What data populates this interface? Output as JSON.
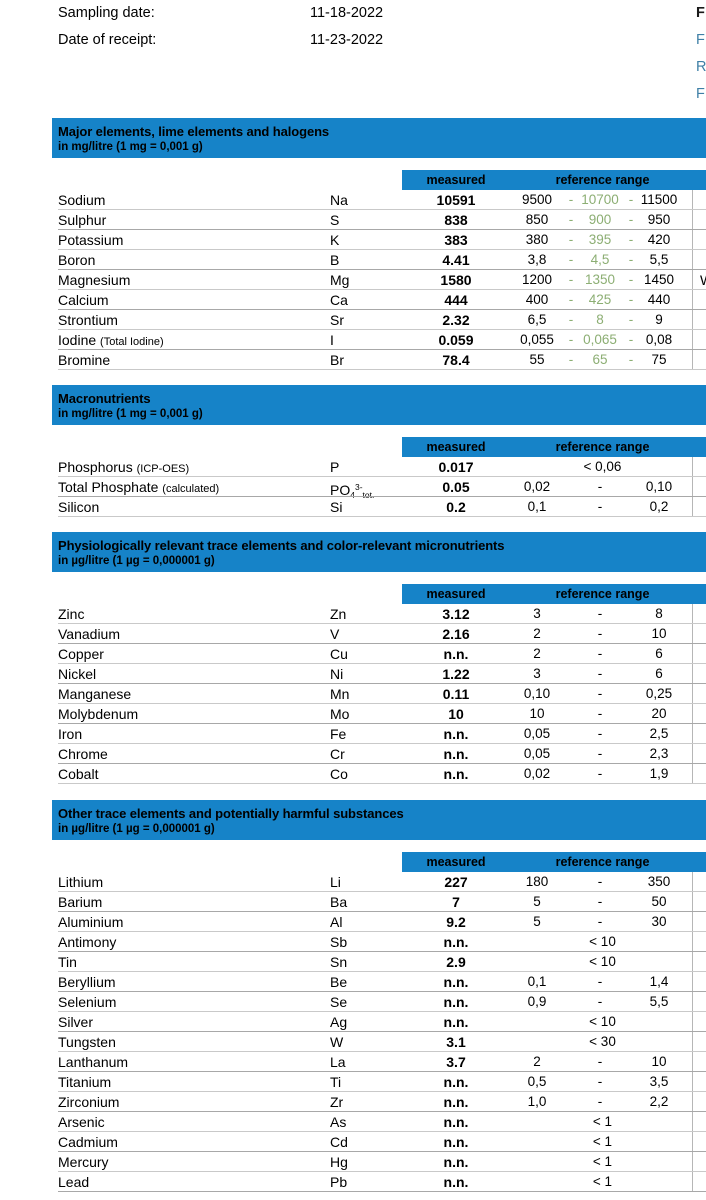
{
  "meta": {
    "rows": [
      {
        "label": "Sampling date:",
        "value": "11-18-2022"
      },
      {
        "label": "Date of receipt:",
        "value": "11-23-2022"
      }
    ]
  },
  "edge_links": [
    {
      "text": "F",
      "bold": true
    },
    {
      "text": "F",
      "bold": false
    },
    {
      "text": "R",
      "bold": false
    },
    {
      "text": "F",
      "bold": false
    }
  ],
  "columns": {
    "measured": "measured",
    "reference_range": "reference range"
  },
  "colors": {
    "section_blue": "#1683c8",
    "optimal_green": "#8cae73",
    "link_blue": "#3f7fa6",
    "rule_grey": "#c9c9c9"
  },
  "sections": [
    {
      "title": "Major elements, lime elements and halogens",
      "unit": "in mg/litre (1 mg = 0,001 g)",
      "rows": [
        {
          "name": "Sodium",
          "symbol": "Na",
          "measured": "10591",
          "low": "9500",
          "mid": "10700",
          "high": "11500"
        },
        {
          "name": "Sulphur",
          "symbol": "S",
          "measured": "838",
          "low": "850",
          "mid": "900",
          "high": "950"
        },
        {
          "name": "Potassium",
          "symbol": "K",
          "measured": "383",
          "low": "380",
          "mid": "395",
          "high": "420"
        },
        {
          "name": "Boron",
          "symbol": "B",
          "measured": "4.41",
          "low": "3,8",
          "mid": "4,5",
          "high": "5,5"
        },
        {
          "name": "Magnesium",
          "symbol": "Mg",
          "measured": "1580",
          "low": "1200",
          "mid": "1350",
          "high": "1450",
          "edge_mark": "W"
        },
        {
          "name": "Calcium",
          "symbol": "Ca",
          "measured": "444",
          "low": "400",
          "mid": "425",
          "high": "440"
        },
        {
          "name": "Strontium",
          "symbol": "Sr",
          "measured": "2.32",
          "low": "6,5",
          "mid": "8",
          "high": "9"
        },
        {
          "name": "Iodine",
          "name_sub": "(Total Iodine)",
          "symbol": "I",
          "measured": "0.059",
          "low": "0,055",
          "mid": "0,065",
          "high": "0,08"
        },
        {
          "name": "Bromine",
          "symbol": "Br",
          "measured": "78.4",
          "low": "55",
          "mid": "65",
          "high": "75"
        }
      ]
    },
    {
      "title": "Macronutrients",
      "unit": "in mg/litre (1 mg = 0,001 g)",
      "rows": [
        {
          "name": "Phosphorus",
          "name_sub": "(ICP-OES)",
          "symbol": "P",
          "measured": "0.017",
          "single": "< 0,06"
        },
        {
          "name": "Total Phosphate",
          "name_sub": "(calculated)",
          "symbol_html": "PO<sub>4</sub><sup>3-</sup><sub>tot.</sub>",
          "symbol": "PO4 3- tot.",
          "measured": "0.05",
          "low": "0,02",
          "dash": "-",
          "high": "0,10"
        },
        {
          "name": "Silicon",
          "symbol": "Si",
          "measured": "0.2",
          "low": "0,1",
          "dash": "-",
          "high": "0,2"
        }
      ]
    },
    {
      "title": "Physiologically relevant trace elements and color-relevant micronutrients",
      "unit": "in µg/litre (1 µg = 0,000001 g)",
      "rows": [
        {
          "name": "Zinc",
          "symbol": "Zn",
          "measured": "3.12",
          "low": "3",
          "dash": "-",
          "high": "8"
        },
        {
          "name": "Vanadium",
          "symbol": "V",
          "measured": "2.16",
          "low": "2",
          "dash": "-",
          "high": "10"
        },
        {
          "name": "Copper",
          "symbol": "Cu",
          "measured": "n.n.",
          "low": "2",
          "dash": "-",
          "high": "6"
        },
        {
          "name": "Nickel",
          "symbol": "Ni",
          "measured": "1.22",
          "low": "3",
          "dash": "-",
          "high": "6"
        },
        {
          "name": "Manganese",
          "symbol": "Mn",
          "measured": "0.11",
          "low": "0,10",
          "dash": "-",
          "high": "0,25"
        },
        {
          "name": "Molybdenum",
          "symbol": "Mo",
          "measured": "10",
          "low": "10",
          "dash": "-",
          "high": "20"
        },
        {
          "name": "Iron",
          "symbol": "Fe",
          "measured": "n.n.",
          "low": "0,05",
          "dash": "-",
          "high": "2,5"
        },
        {
          "name": "Chrome",
          "symbol": "Cr",
          "measured": "n.n.",
          "low": "0,05",
          "dash": "-",
          "high": "2,3"
        },
        {
          "name": "Cobalt",
          "symbol": "Co",
          "measured": "n.n.",
          "low": "0,02",
          "dash": "-",
          "high": "1,9"
        }
      ]
    },
    {
      "title": "Other trace elements and potentially harmful substances",
      "unit": "in µg/litre (1 µg = 0,000001 g)",
      "rows": [
        {
          "name": "Lithium",
          "symbol": "Li",
          "measured": "227",
          "low": "180",
          "dash": "-",
          "high": "350"
        },
        {
          "name": "Barium",
          "symbol": "Ba",
          "measured": "7",
          "low": "5",
          "dash": "-",
          "high": "50"
        },
        {
          "name": "Aluminium",
          "symbol": "Al",
          "measured": "9.2",
          "low": "5",
          "dash": "-",
          "high": "30"
        },
        {
          "name": "Antimony",
          "symbol": "Sb",
          "measured": "n.n.",
          "single": "< 10"
        },
        {
          "name": "Tin",
          "symbol": "Sn",
          "measured": "2.9",
          "single": "< 10"
        },
        {
          "name": "Beryllium",
          "symbol": "Be",
          "measured": "n.n.",
          "low": "0,1",
          "dash": "-",
          "high": "1,4"
        },
        {
          "name": "Selenium",
          "symbol": "Se",
          "measured": "n.n.",
          "low": "0,9",
          "dash": "-",
          "high": "5,5"
        },
        {
          "name": "Silver",
          "symbol": "Ag",
          "measured": "n.n.",
          "single": "< 10"
        },
        {
          "name": "Tungsten",
          "symbol": "W",
          "measured": "3.1",
          "single": "< 30"
        },
        {
          "name": "Lanthanum",
          "symbol": "La",
          "measured": "3.7",
          "low": "2",
          "dash": "-",
          "high": "10"
        },
        {
          "name": "Titanium",
          "symbol": "Ti",
          "measured": "n.n.",
          "low": "0,5",
          "dash": "-",
          "high": "3,5"
        },
        {
          "name": "Zirconium",
          "symbol": "Zr",
          "measured": "n.n.",
          "low": "1,0",
          "dash": "-",
          "high": "2,2"
        },
        {
          "name": "Arsenic",
          "symbol": "As",
          "measured": "n.n.",
          "single": "< 1"
        },
        {
          "name": "Cadmium",
          "symbol": "Cd",
          "measured": "n.n.",
          "single": "< 1"
        },
        {
          "name": "Mercury",
          "symbol": "Hg",
          "measured": "n.n.",
          "single": "< 1"
        },
        {
          "name": "Lead",
          "symbol": "Pb",
          "measured": "n.n.",
          "single": "< 1"
        }
      ]
    }
  ],
  "layout": {
    "section_tops": [
      118,
      385,
      532,
      800
    ],
    "head_heights": [
      40,
      40,
      40,
      40
    ],
    "colhead_tops": [
      170,
      437,
      584,
      852
    ],
    "rows_tops": [
      190,
      457,
      604,
      872
    ]
  }
}
